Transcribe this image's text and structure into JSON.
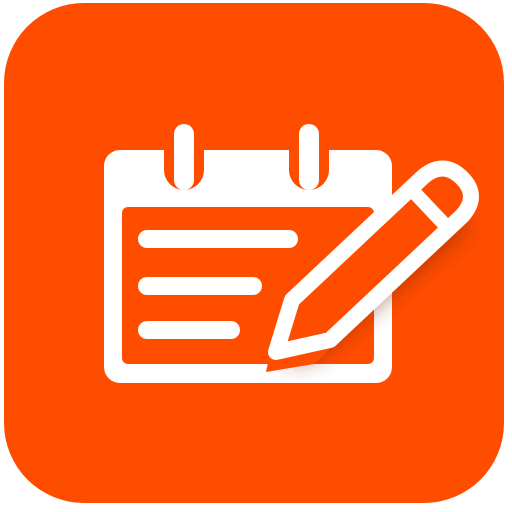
{
  "app_icon": {
    "icon": "calendar-note-pencil-icon",
    "colors": {
      "background": "#FF4D00",
      "foreground": "#FFFFFF",
      "shadow": "#7A2200"
    }
  }
}
